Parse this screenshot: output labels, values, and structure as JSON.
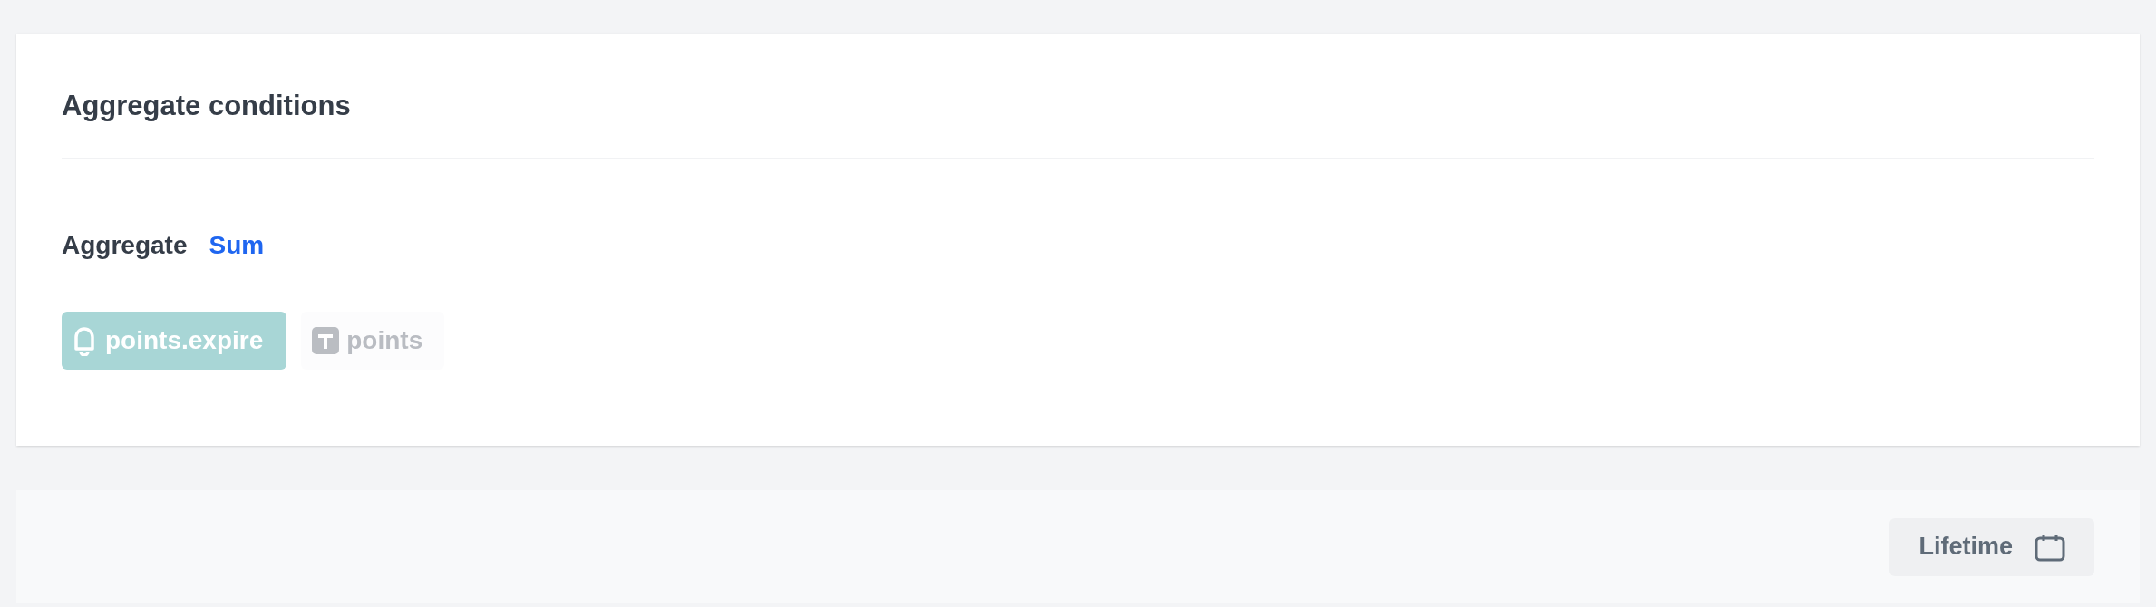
{
  "card": {
    "title": "Aggregate conditions",
    "aggregate": {
      "label": "Aggregate",
      "value": "Sum"
    },
    "chips": [
      {
        "kind": "event",
        "label": "points.expire",
        "active": true
      },
      {
        "kind": "attribute",
        "label": "points",
        "active": false
      }
    ]
  },
  "footer": {
    "period_button": "Lifetime"
  }
}
